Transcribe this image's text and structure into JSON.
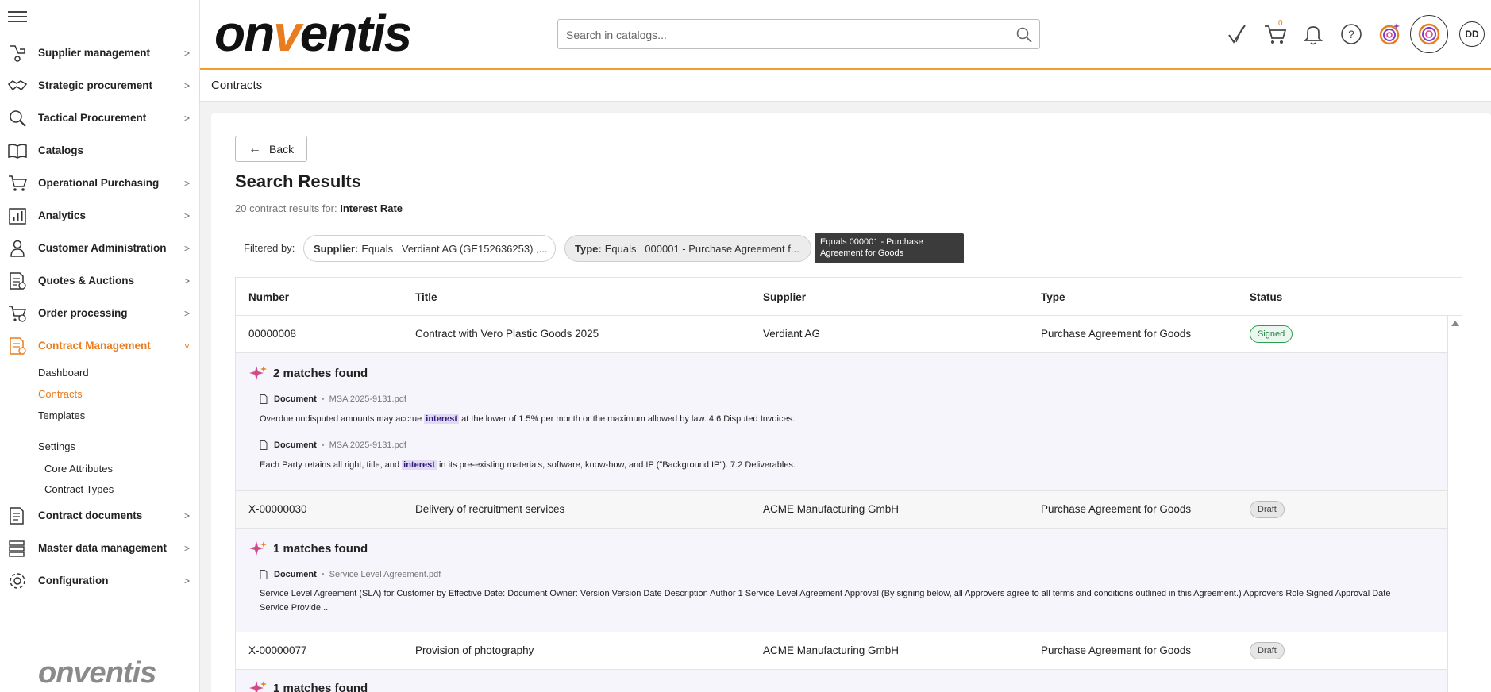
{
  "sidebar": {
    "items": [
      {
        "label": "Supplier management",
        "icon": "supplier-icon",
        "expanded": false
      },
      {
        "label": "Strategic procurement",
        "icon": "handshake-icon",
        "expanded": false
      },
      {
        "label": "Tactical Procurement",
        "icon": "magnifier-icon",
        "expanded": false
      },
      {
        "label": "Catalogs",
        "icon": "book-icon",
        "expanded": false
      },
      {
        "label": "Operational Purchasing",
        "icon": "cart-icon",
        "expanded": false
      },
      {
        "label": "Analytics",
        "icon": "bar-chart-icon",
        "expanded": false
      },
      {
        "label": "Customer Administration",
        "icon": "person-icon",
        "expanded": false
      },
      {
        "label": "Quotes & Auctions",
        "icon": "quote-doc-icon",
        "expanded": false
      },
      {
        "label": "Order processing",
        "icon": "order-cart-icon",
        "expanded": false
      },
      {
        "label": "Contract Management",
        "icon": "contract-icon",
        "expanded": true
      },
      {
        "label": "Contract documents",
        "icon": "contract-doc-icon",
        "expanded": false
      },
      {
        "label": "Master data management",
        "icon": "database-icon",
        "expanded": false
      },
      {
        "label": "Configuration",
        "icon": "gear-icon",
        "expanded": false
      }
    ],
    "contract_sub": {
      "dashboard": "Dashboard",
      "contracts": "Contracts",
      "templates": "Templates",
      "settings": "Settings",
      "core_attributes": "Core Attributes",
      "contract_types": "Contract Types"
    },
    "logo_text": "onventis"
  },
  "header": {
    "logo": "onventis",
    "search_placeholder": "Search in catalogs...",
    "cart_count": "0",
    "avatar_initials": "DD",
    "accent": "#e87c1e"
  },
  "breadcrumb": "Contracts",
  "back_label": "Back",
  "page_title": "Search Results",
  "results": {
    "prefix": "20 contract results for:",
    "query": "Interest Rate"
  },
  "filters": {
    "label": "Filtered by:",
    "chips": [
      {
        "key": "Supplier:",
        "value": "Equals   Verdiant AG (GE152636253) ,..."
      },
      {
        "key": "Type:",
        "value": "Equals   000001 - Purchase Agreement f..."
      }
    ],
    "tooltip": "Equals 000001 - Purchase Agreement for Goods"
  },
  "table": {
    "columns": [
      "Number",
      "Title",
      "Supplier",
      "Type",
      "Status"
    ],
    "rows": [
      {
        "number": "00000008",
        "title": "Contract with Vero Plastic Goods 2025",
        "supplier": "Verdiant AG",
        "type": "Purchase Agreement for Goods",
        "status": "Signed",
        "matches_title": "2 matches found",
        "matches": [
          {
            "kind": "Document",
            "file": "MSA 2025-9131.pdf",
            "pre": "Overdue undisputed amounts may accrue ",
            "hl": "interest",
            "post": " at the lower of 1.5% per month or the maximum allowed by law. 4.6 Disputed Invoices."
          },
          {
            "kind": "Document",
            "file": "MSA 2025-9131.pdf",
            "pre": "Each Party retains all right, title, and ",
            "hl": "interest",
            "post": " in its pre-existing materials, software, know-how, and IP (\"Background IP\"). 7.2 Deliverables."
          }
        ]
      },
      {
        "number": "X-00000030",
        "title": "Delivery of recruitment services",
        "supplier": "ACME Manufacturing GmbH",
        "type": "Purchase Agreement for Goods",
        "status": "Draft",
        "matches_title": "1 matches found",
        "matches": [
          {
            "kind": "Document",
            "file": "Service Level Agreement.pdf",
            "pre": "Service Level Agreement (SLA) for Customer by Effective Date: Document Owner: Version Version Date Description Author 1 Service Level Agreement Approval (By signing below, all Approvers agree to all terms and conditions outlined in this Agreement.) Approvers Role Signed Approval Date Service Provide...",
            "hl": "",
            "post": ""
          }
        ]
      },
      {
        "number": "X-00000077",
        "title": "Provision of photography",
        "supplier": "ACME Manufacturing GmbH",
        "type": "Purchase Agreement for Goods",
        "status": "Draft",
        "matches_title": "1 matches found",
        "matches": []
      }
    ]
  }
}
